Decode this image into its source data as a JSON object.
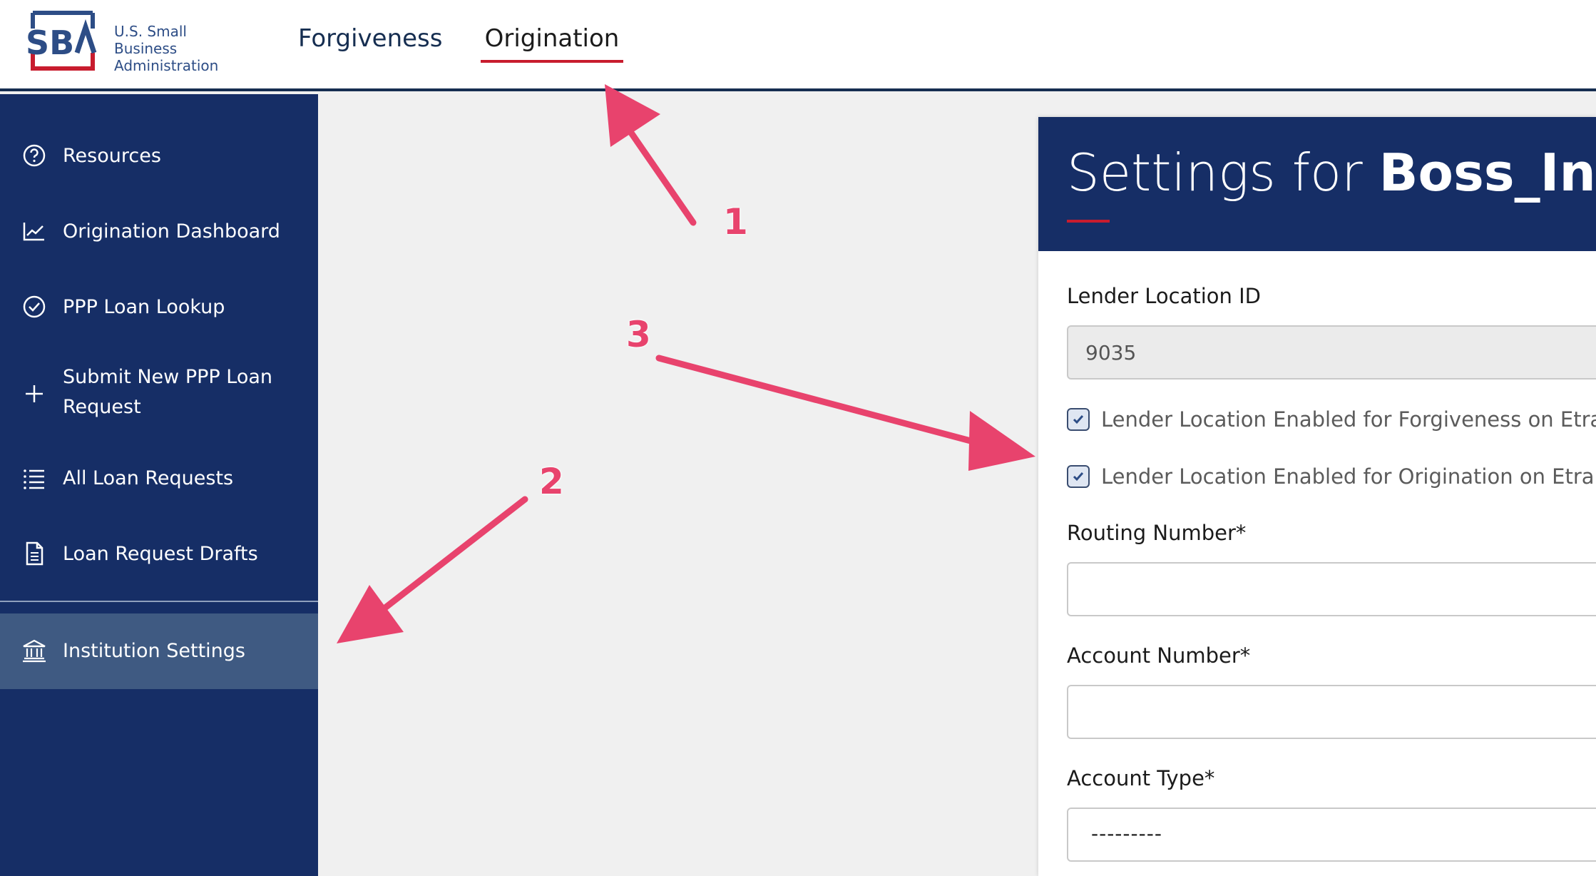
{
  "header": {
    "logo_text_line1": "U.S. Small Business",
    "logo_text_line2": "Administration",
    "logo_mark": "SBA",
    "tabs": [
      {
        "label": "Forgiveness"
      },
      {
        "label": "Origination"
      }
    ]
  },
  "sidebar": {
    "items": [
      {
        "label": "Resources",
        "icon": "question-circle-icon"
      },
      {
        "label": "Origination Dashboard",
        "icon": "chart-line-icon"
      },
      {
        "label": "PPP Loan Lookup",
        "icon": "check-circle-icon"
      },
      {
        "label_line1": "Submit New PPP Loan",
        "label_line2": "Request",
        "icon": "plus-icon"
      },
      {
        "label": "All Loan Requests",
        "icon": "list-icon"
      },
      {
        "label": "Loan Request Drafts",
        "icon": "document-icon"
      },
      {
        "label": "Institution Settings",
        "icon": "bank-icon"
      }
    ]
  },
  "panel": {
    "title_prefix": "Settings for ",
    "title_name": "Boss_Insig",
    "fields": {
      "lender_location_label": "Lender Location ID",
      "lender_location_value": "9035",
      "checkbox_forgiveness": "Lender Location Enabled for Forgiveness on Etran",
      "checkbox_origination": "Lender Location Enabled for Origination on Etran",
      "routing_label": "Routing Number*",
      "routing_value": "",
      "account_number_label": "Account Number*",
      "account_number_value": "",
      "account_type_label": "Account Type*",
      "account_type_value": "---------"
    }
  },
  "annotations": [
    "1",
    "2",
    "3"
  ],
  "colors": {
    "navy": "#162e66",
    "accent_red": "#c81c2e",
    "annotation_pink": "#e8436d",
    "active_item": "#3f5a82"
  }
}
